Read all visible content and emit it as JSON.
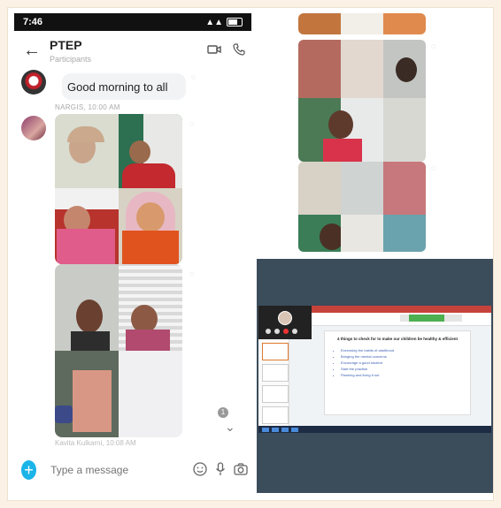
{
  "status_bar": {
    "time": "7:46",
    "right": "0 ..."
  },
  "chat": {
    "title": "PTEP",
    "subtitle": "Participants",
    "greeting_message": "Good morning to all",
    "sender_label": "NARGIS, 10:00 AM",
    "sender2_label": "Kavita Kulkarni, 10:08 AM",
    "unread_count": "1",
    "input_placeholder": "Type a message"
  },
  "slide": {
    "title": "4 things to check for to make our children be healthy & efficient",
    "bullets": [
      "Exercising the habits of adulthood",
      "Bringing the mental concerns",
      "Encourage a good student",
      "Start the practise",
      "Planning and living it out"
    ]
  },
  "icons": {
    "back": "arrow-left-icon",
    "video": "video-camera-icon",
    "phone": "phone-icon",
    "add": "plus-icon",
    "emoji": "smiley-icon",
    "mic": "microphone-icon",
    "camera": "camera-icon"
  },
  "colors": {
    "accent": "#1bb4e8",
    "ppt": "#c6433b",
    "background": "#fbf1e4"
  }
}
